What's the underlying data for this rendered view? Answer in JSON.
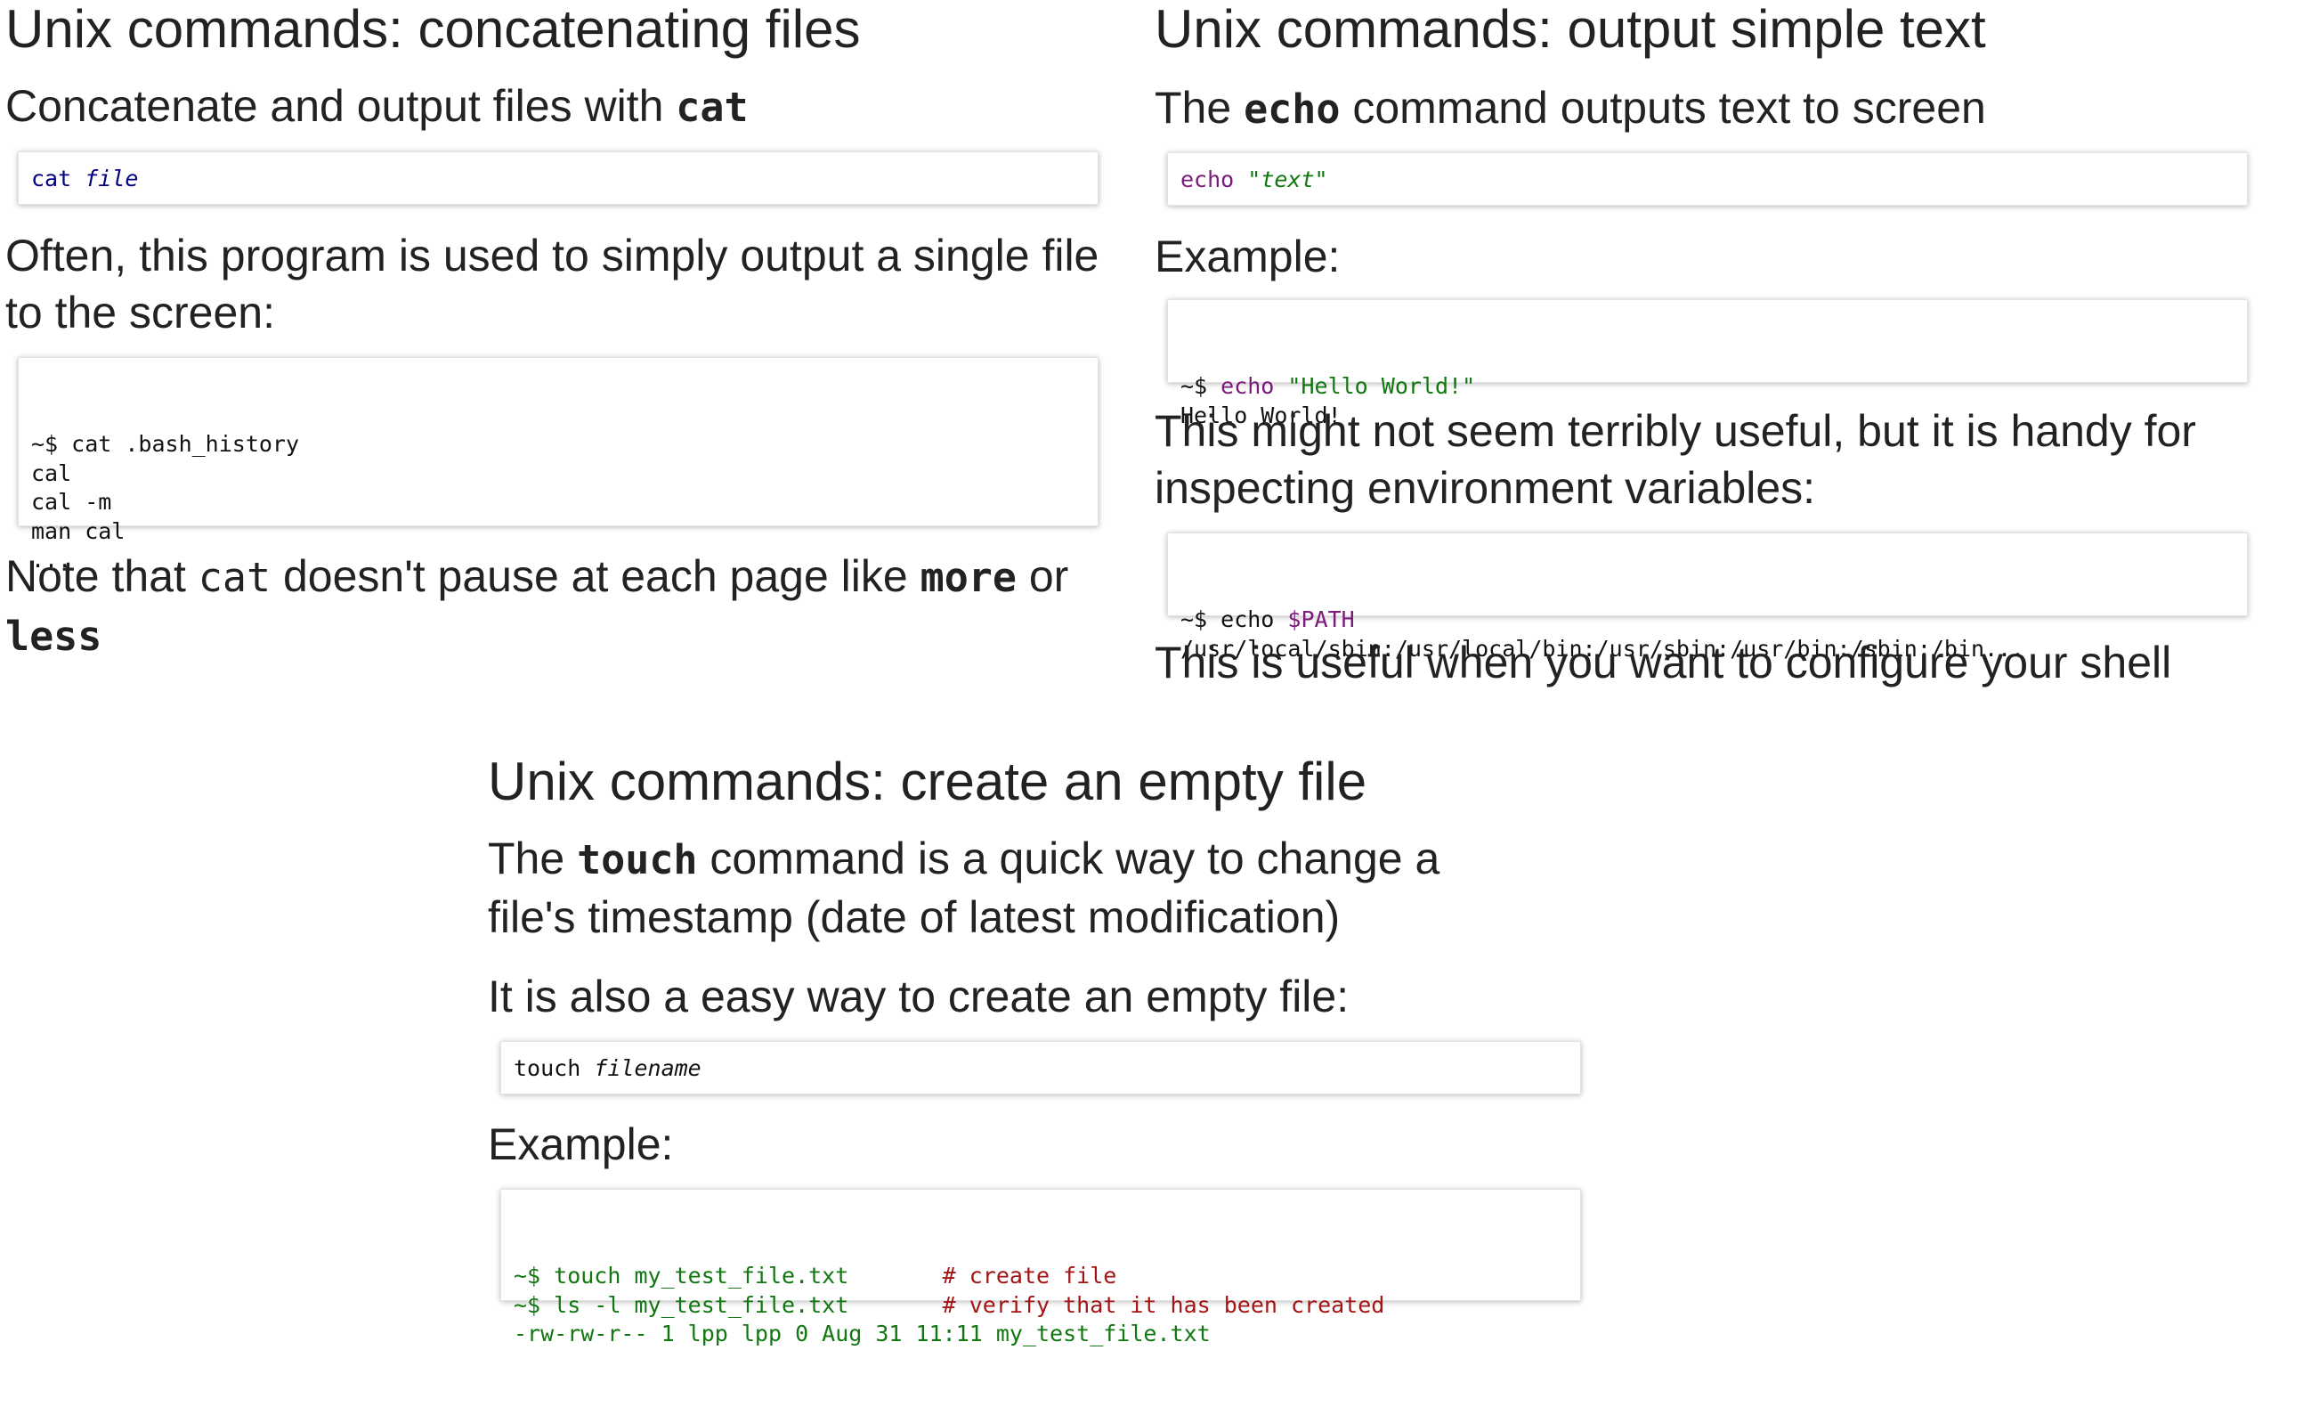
{
  "slides": {
    "cat": {
      "title": "Unix commands: concatenating files",
      "intro_text": "Concatenate and output files with ",
      "intro_code": "cat",
      "syntax_cmd": "cat ",
      "syntax_arg": "file",
      "para2": "Often, this program is used to simply output a single file to the screen:",
      "example_lines": [
        "~$ cat .bash_history",
        "cal",
        "cal -m",
        "man cal",
        "..."
      ],
      "note_text_1": "Note that ",
      "note_code_1": "cat",
      "note_text_2": " doesn't pause at each page like ",
      "note_code_2": "more",
      "note_text_3": " or ",
      "note_code_3": "less"
    },
    "echo": {
      "title": "Unix commands: output simple text",
      "intro_text_1": "The ",
      "intro_code": "echo",
      "intro_text_2": " command outputs text to screen",
      "syntax_cmd": "echo ",
      "syntax_arg": "\"text\"",
      "example_label": "Example:",
      "example_prompt": "~$ ",
      "example_cmd": "echo ",
      "example_arg": "\"Hello World!\"",
      "example_output": "Hello World!",
      "para3": "This might not seem terribly useful, but it is handy for inspecting environment variables:",
      "path_prompt": "~$ echo ",
      "path_var": "$PATH",
      "path_output": "/usr/local/sbin:/usr/local/bin:/usr/sbin:/usr/bin:/sbin:/bin...",
      "para4": "This is useful when you want to configure your shell"
    },
    "touch": {
      "title": "Unix commands: create an empty file",
      "intro_text_1": "The ",
      "intro_code": "touch",
      "intro_text_2": " command is a quick way to change a file's timestamp (date of latest modification)",
      "para2": "It is also a easy way to create an empty file:",
      "syntax_cmd": "touch ",
      "syntax_arg": "filename",
      "example_label": "Example:",
      "line1_cmd": "~$ touch my_test_file.txt       ",
      "line1_comment": "# create file",
      "line2_cmd": "~$ ls -l my_test_file.txt       ",
      "line2_comment": "# verify that it has been created",
      "line3_output": "-rw-rw-r-- 1 lpp lpp 0 Aug 31 11:11 my_test_file.txt"
    }
  }
}
